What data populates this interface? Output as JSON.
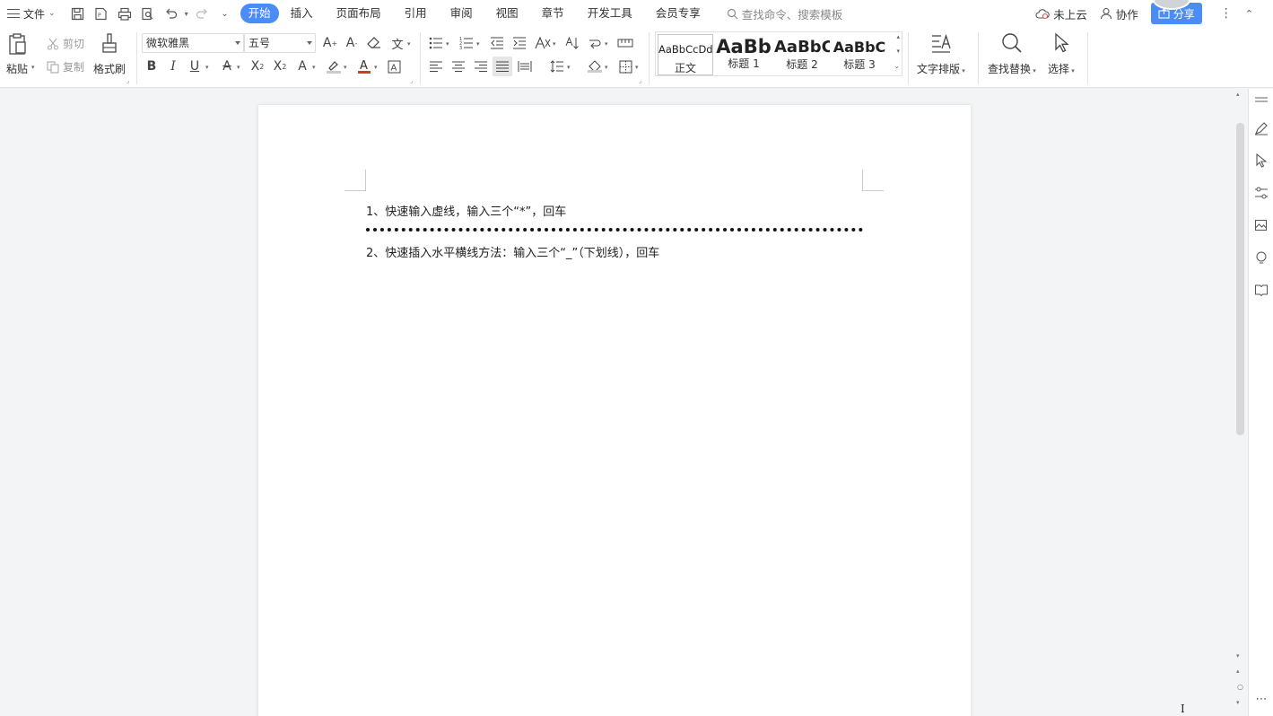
{
  "topbar": {
    "file_label": "文件",
    "tabs": [
      {
        "label": "开始",
        "active": true
      },
      {
        "label": "插入"
      },
      {
        "label": "页面布局"
      },
      {
        "label": "引用"
      },
      {
        "label": "审阅"
      },
      {
        "label": "视图"
      },
      {
        "label": "章节"
      },
      {
        "label": "开发工具"
      },
      {
        "label": "会员专享"
      }
    ],
    "search_placeholder": "查找命令、搜索模板",
    "cloud_label": "未上云",
    "collab_label": "协作",
    "share_label": "分享"
  },
  "ribbon": {
    "paste_label": "粘贴",
    "cut_label": "剪切",
    "copy_label": "复制",
    "format_painter_label": "格式刷",
    "font_name": "微软雅黑",
    "font_size": "五号",
    "styles": [
      {
        "sample": "AaBbCcDd",
        "name": "正文"
      },
      {
        "sample": "AaBb",
        "name": "标题 1"
      },
      {
        "sample": "AaBbC",
        "name": "标题 2"
      },
      {
        "sample": "AaBbC",
        "name": "标题 3"
      }
    ],
    "text_layout_label": "文字排版",
    "find_replace_label": "查找替换",
    "select_label": "选择"
  },
  "document": {
    "line1": "1、快速输入虚线，输入三个“*”，回车",
    "line2": "2、快速插入水平横线方法：输入三个“_”（下划线），回车"
  },
  "colors": {
    "accent": "#4a8df6"
  }
}
